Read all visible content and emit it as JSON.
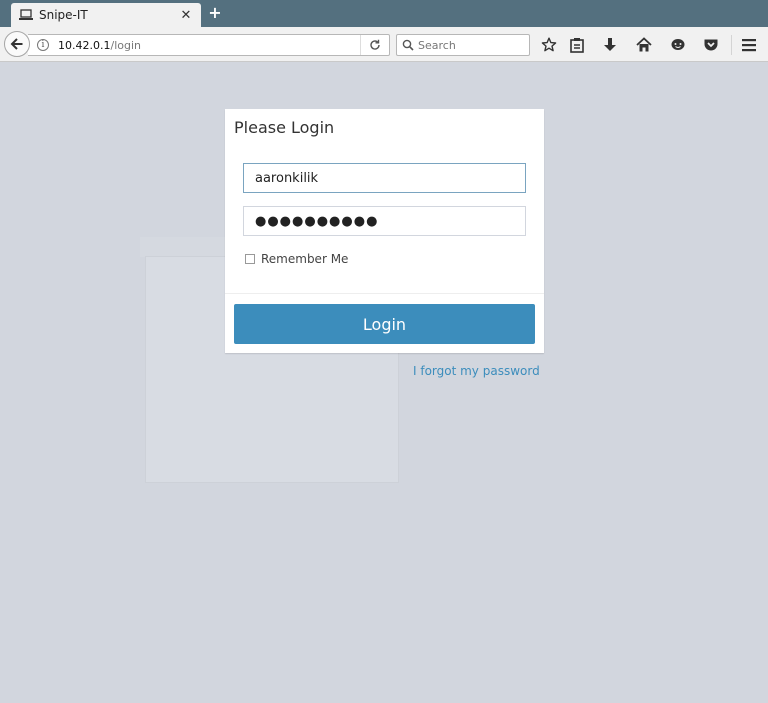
{
  "browser": {
    "tab_title": "Snipe-IT",
    "tab_close": "✕",
    "new_tab": "+",
    "url_host": "10.42.0.1",
    "url_path": "/login",
    "search_placeholder": "Search"
  },
  "login": {
    "title": "Please Login",
    "username_value": "aaronkilik",
    "password_value": "●●●●●●●●●●",
    "remember_label": "Remember Me",
    "remember_checked": false,
    "button_label": "Login",
    "forgot_link": "I forgot my password"
  },
  "colors": {
    "tabbar": "#54707f",
    "page_background": "#d2d6de",
    "primary": "#3c8dbc"
  },
  "icons": [
    "laptop-icon",
    "close-icon",
    "plus-icon",
    "back-arrow-icon",
    "info-icon",
    "reload-icon",
    "search-icon",
    "star-icon",
    "clipboard-icon",
    "download-icon",
    "home-icon",
    "chat-icon",
    "pocket-icon",
    "hamburger-menu-icon"
  ]
}
